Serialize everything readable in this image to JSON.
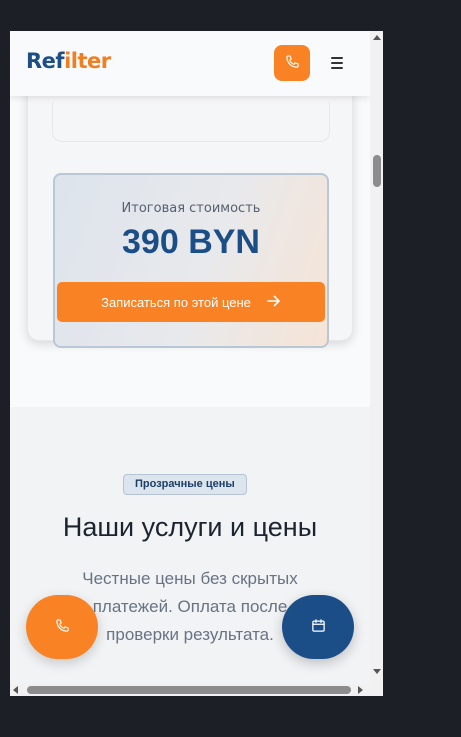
{
  "header": {
    "logo_part1": "Ref",
    "logo_part2": "ilter",
    "phone_icon": "phone-icon",
    "menu_icon": "hamburger-menu-icon"
  },
  "calculator": {
    "total_label": "Итоговая стоимость",
    "total_value": "390 BYN",
    "book_button_label": "Записаться по этой цене",
    "book_button_icon": "arrow-right-icon"
  },
  "services": {
    "badge": "Прозрачные цены",
    "title": "Наши услуги и цены",
    "description": "Честные цены без скрытых платежей. Оплата после проверки результата."
  },
  "floating": {
    "call_icon": "phone-icon",
    "calendar_icon": "calendar-icon"
  },
  "colors": {
    "accent_orange": "#f98224",
    "brand_blue": "#1b4e87",
    "text_dark": "#1c2430",
    "muted_text": "#687384"
  }
}
